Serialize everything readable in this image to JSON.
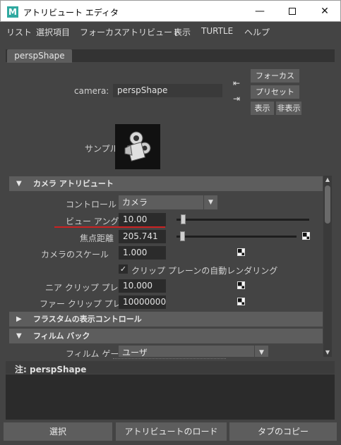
{
  "window": {
    "title": "アトリビュート エディタ",
    "app_icon_letter": "M",
    "minimize": "—",
    "close": "✕"
  },
  "menu": {
    "items": [
      "リスト",
      "選択項目",
      "フォーカス",
      "アトリビュート",
      "表示",
      "TURTLE",
      "ヘルプ"
    ]
  },
  "tab": {
    "label": "perspShape"
  },
  "camera": {
    "label": "camera:",
    "value": "perspShape"
  },
  "buttons": {
    "focus": "フォーカス",
    "presets": "プリセット",
    "show": "表示",
    "hide": "非表示"
  },
  "sample": {
    "label": "サンプル"
  },
  "sections": {
    "camera_attributes": "カメラ アトリビュート",
    "frustum_display": "フラスタムの表示コントロール",
    "film_back": "フィルム バック"
  },
  "attributes": {
    "control_label": "コントロール",
    "control_value": "カメラ",
    "view_angle_label": "ビュー アングル",
    "view_angle_value": "10.00",
    "view_angle_fraction": 0.03,
    "focal_length_label": "焦点距離",
    "focal_length_value": "205.741",
    "focal_length_fraction": 0.03,
    "camera_scale_label": "カメラのスケール",
    "camera_scale_value": "1.000",
    "auto_render_clip_label": "クリップ プレーンの自動レンダリング",
    "auto_render_clip_checked": true,
    "near_clip_label": "ニア クリップ プレーン",
    "near_clip_value": "10.000",
    "far_clip_label": "ファー クリップ プレーン",
    "far_clip_value": "10000000.0",
    "film_gate_label": "フィルム ゲート",
    "film_gate_value": "ユーザ"
  },
  "notes": {
    "label": "注:  perspShape"
  },
  "bottom": {
    "select": "選択",
    "load_attributes": "アトリビュートのロード",
    "copy_tab": "タブのコピー"
  },
  "colors": {
    "accent_underline": "#cc2222",
    "app_icon": "#2fa9a0"
  }
}
